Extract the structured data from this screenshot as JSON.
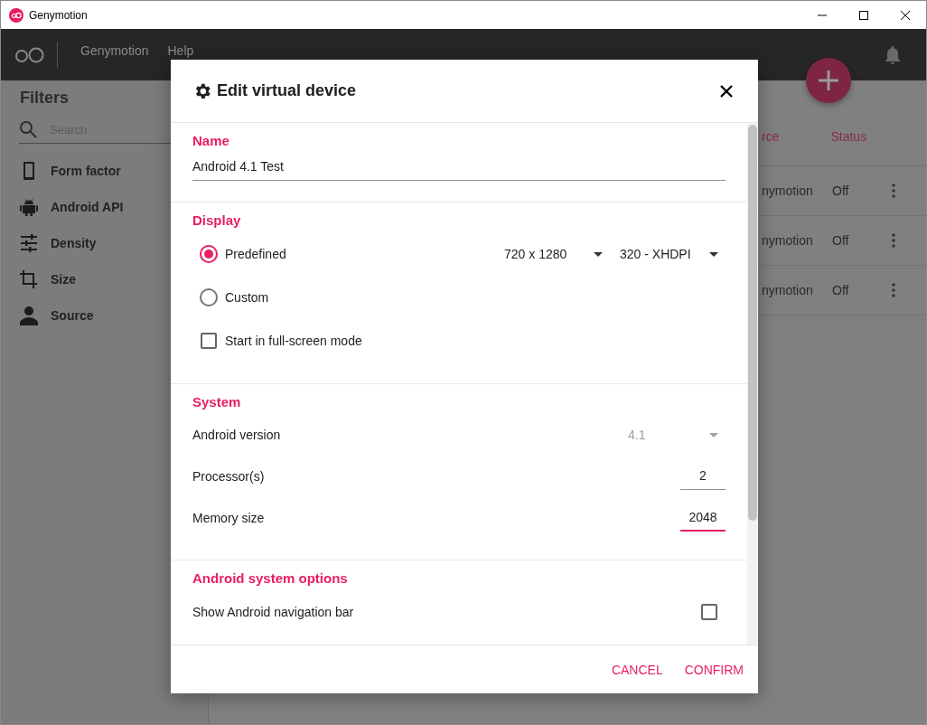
{
  "window": {
    "title": "Genymotion"
  },
  "toolbar": {
    "menus": [
      "Genymotion",
      "Help"
    ]
  },
  "sidebar": {
    "title": "Filters",
    "search": {
      "placeholder": "Search"
    },
    "filters": [
      {
        "label": "Form factor"
      },
      {
        "label": "Android API"
      },
      {
        "label": "Density"
      },
      {
        "label": "Size"
      },
      {
        "label": "Source"
      }
    ]
  },
  "table": {
    "columns": [
      "rce",
      "Status"
    ],
    "rows": [
      {
        "column_1": "nymotion",
        "status": "Off"
      },
      {
        "column_1": "nymotion",
        "status": "Off"
      },
      {
        "column_1": "nymotion",
        "status": "Off"
      }
    ]
  },
  "dialog": {
    "title": "Edit virtual device",
    "sections": [
      {
        "heading": "Name",
        "items": [
          {
            "kind": "text",
            "value": "Android 4.1 Test"
          }
        ]
      },
      {
        "heading": "Display",
        "items": [
          {
            "kind": "radio",
            "label": "Predefined",
            "selected": true,
            "dropdowns": [
              "720 x 1280",
              "320 - XHDPI"
            ]
          },
          {
            "kind": "radio",
            "label": "Custom",
            "selected": false
          },
          {
            "kind": "checkbox",
            "label": "Start in full-screen mode",
            "checked": false
          }
        ]
      },
      {
        "heading": "System",
        "items": [
          {
            "kind": "select",
            "label": "Android version",
            "value": "4.1",
            "disabled": true
          },
          {
            "kind": "number",
            "label": "Processor(s)",
            "value": "2",
            "focused": false
          },
          {
            "kind": "number",
            "label": "Memory size",
            "value": "2048",
            "focused": true
          }
        ]
      },
      {
        "heading": "Android system options",
        "items": [
          {
            "kind": "switch_check",
            "label": "Show Android navigation bar",
            "checked": false
          }
        ]
      }
    ],
    "buttons": [
      "CANCEL",
      "CONFIRM"
    ]
  }
}
